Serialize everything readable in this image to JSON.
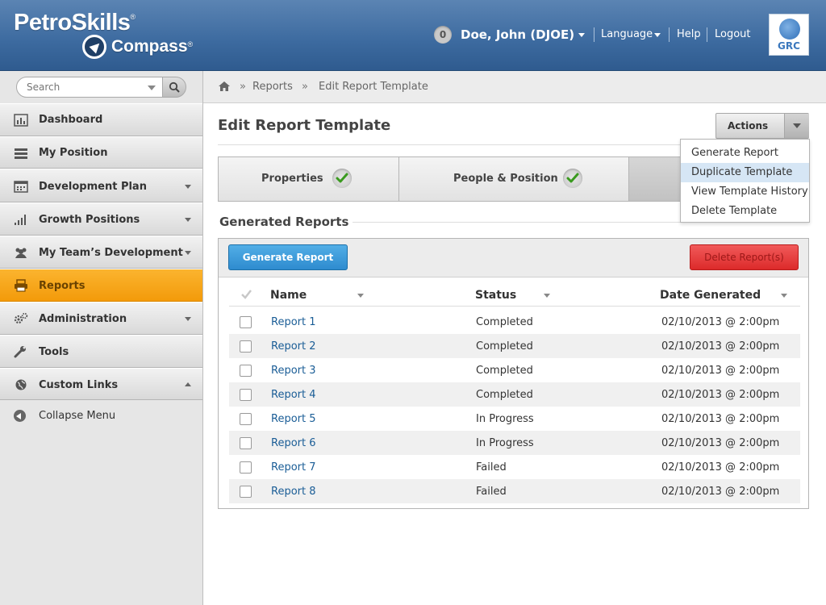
{
  "brand": {
    "name_top": "PetroSkills",
    "name_bottom": "Compass",
    "registered": "®",
    "badge": "GRC"
  },
  "user_bar": {
    "notification_count": "0",
    "user_name": "Doe, John (DJOE)",
    "language_label": "Language",
    "help_label": "Help",
    "logout_label": "Logout"
  },
  "sidebar": {
    "search_placeholder": "Search",
    "items": [
      {
        "label": "Dashboard",
        "icon": "bar-chart-icon"
      },
      {
        "label": "My Position",
        "icon": "list-icon"
      },
      {
        "label": "Development Plan",
        "icon": "calendar-icon"
      },
      {
        "label": "Growth Positions",
        "icon": "signal-bars-icon"
      },
      {
        "label": "My Team’s Development",
        "icon": "team-icon"
      },
      {
        "label": "Reports",
        "icon": "printer-icon"
      },
      {
        "label": "Administration",
        "icon": "gears-icon"
      },
      {
        "label": "Tools",
        "icon": "wrench-icon"
      },
      {
        "label": "Custom Links",
        "icon": "globe-icon"
      }
    ],
    "collapse_label": "Collapse Menu",
    "active_color": "#f7a518"
  },
  "breadcrumb": {
    "items": [
      "Reports",
      "Edit Report Template"
    ],
    "separator": "»"
  },
  "main": {
    "title": "Edit Report Template",
    "actions_label": "Actions",
    "actions_menu": [
      "Generate Report",
      "Duplicate Template",
      "View Template History",
      "Delete Template"
    ],
    "tabs": [
      "Properties",
      "People & Position"
    ],
    "section_title": "Generated Reports",
    "generate_button": "Generate Report",
    "delete_button": "Delete Report(s)",
    "columns": [
      "Name",
      "Status",
      "Date Generated"
    ],
    "rows": [
      {
        "name": "Report 1",
        "status": "Completed",
        "date": "02/10/2013 @ 2:00pm"
      },
      {
        "name": "Report 2",
        "status": "Completed",
        "date": "02/10/2013 @ 2:00pm"
      },
      {
        "name": "Report 3",
        "status": "Completed",
        "date": "02/10/2013 @ 2:00pm"
      },
      {
        "name": "Report 4",
        "status": "Completed",
        "date": "02/10/2013 @ 2:00pm"
      },
      {
        "name": "Report 5",
        "status": "In Progress",
        "date": "02/10/2013 @ 2:00pm"
      },
      {
        "name": "Report 6",
        "status": "In Progress",
        "date": "02/10/2013 @ 2:00pm"
      },
      {
        "name": "Report 7",
        "status": "Failed",
        "date": "02/10/2013 @ 2:00pm"
      },
      {
        "name": "Report 8",
        "status": "Failed",
        "date": "02/10/2013 @ 2:00pm"
      }
    ]
  }
}
